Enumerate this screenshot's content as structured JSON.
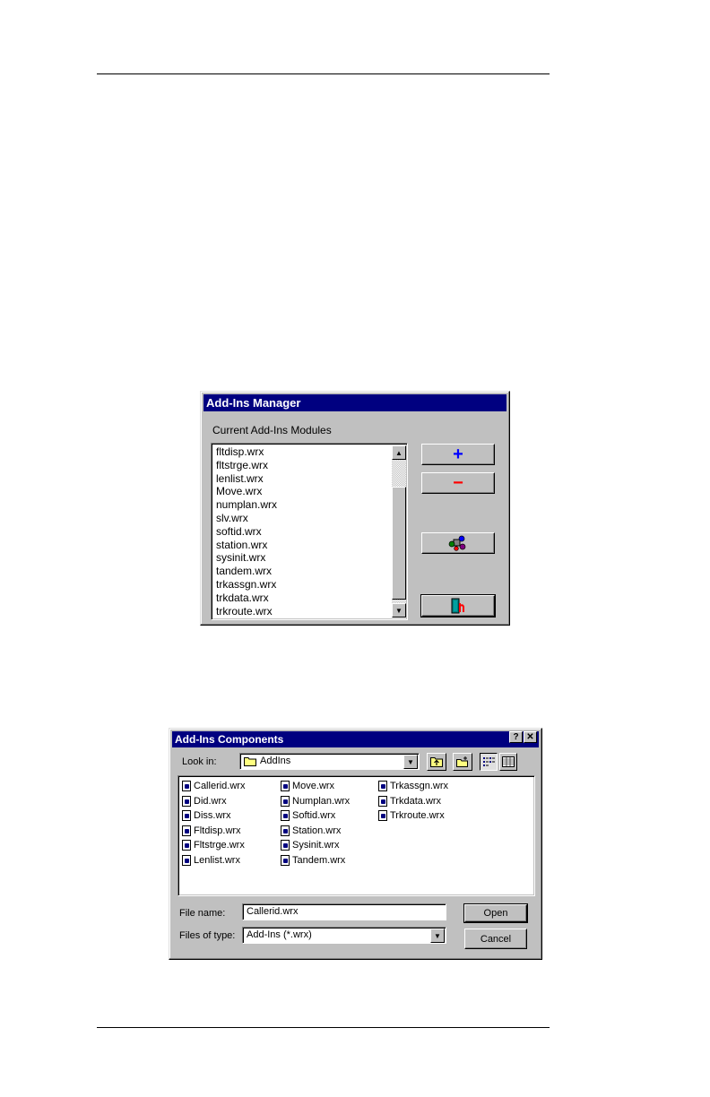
{
  "manager": {
    "title": "Add-Ins Manager",
    "list_label": "Current Add-Ins Modules",
    "modules": [
      "fltdisp.wrx",
      "fltstrge.wrx",
      "lenlist.wrx",
      "Move.wrx",
      "numplan.wrx",
      "slv.wrx",
      "softid.wrx",
      "station.wrx",
      "sysinit.wrx",
      "tandem.wrx",
      "trkassgn.wrx",
      "trkdata.wrx",
      "trkroute.wrx"
    ],
    "add_label": "+",
    "remove_label": "−",
    "colors": {
      "titlebar": "#000080",
      "add": "#0000ff",
      "remove": "#ff0000"
    }
  },
  "components": {
    "title": "Add-Ins Components",
    "help_label": "?",
    "close_label": "✕",
    "look_in_label": "Look in:",
    "look_in_value": "AddIns",
    "files": [
      [
        "Callerid.wrx",
        "Did.wrx",
        "Diss.wrx",
        "Fltdisp.wrx",
        "Fltstrge.wrx",
        "Lenlist.wrx"
      ],
      [
        "Move.wrx",
        "Numplan.wrx",
        "Softid.wrx",
        "Station.wrx",
        "Sysinit.wrx",
        "Tandem.wrx"
      ],
      [
        "Trkassgn.wrx",
        "Trkdata.wrx",
        "Trkroute.wrx"
      ]
    ],
    "file_name_label": "File name:",
    "file_name_value": "Callerid.wrx",
    "file_type_label": "Files of type:",
    "file_type_value": "Add-Ins (*.wrx)",
    "open_label": "Open",
    "cancel_label": "Cancel"
  }
}
